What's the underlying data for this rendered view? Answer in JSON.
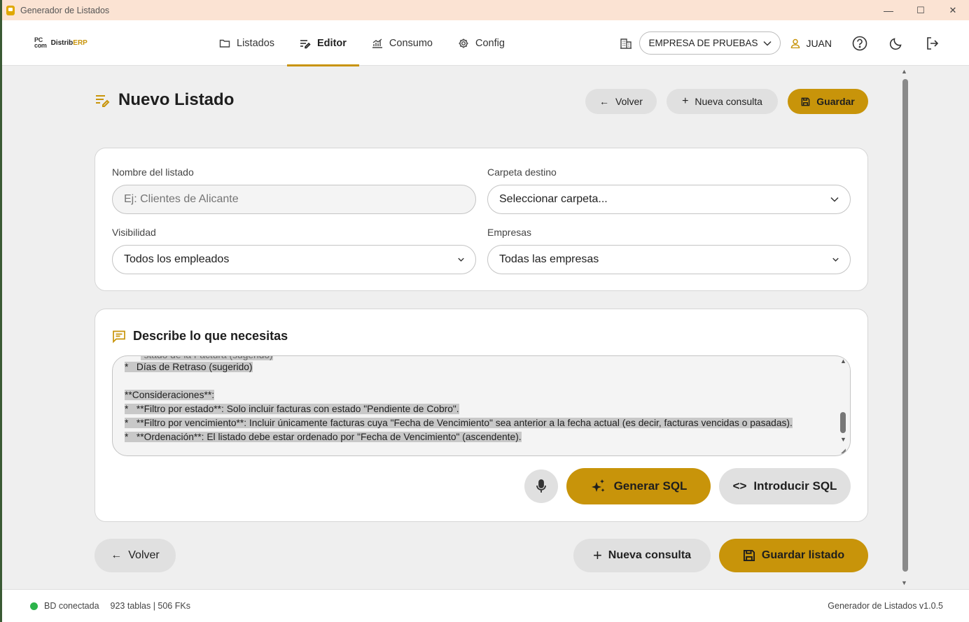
{
  "window": {
    "title": "Generador de Listados",
    "minimize": "—",
    "maximize": "☐",
    "close": "✕"
  },
  "logo": {
    "pc_top": "PC",
    "pc_bottom": "com",
    "distrib": "Distrib",
    "erp": "ERP"
  },
  "nav": {
    "tabs": [
      {
        "label": "Listados",
        "icon": "folder-icon"
      },
      {
        "label": "Editor",
        "icon": "edit-list-icon",
        "active": true
      },
      {
        "label": "Consumo",
        "icon": "chart-icon"
      },
      {
        "label": "Config",
        "icon": "gear-icon"
      }
    ],
    "company": "EMPRESA DE PRUEBAS",
    "user": "JUAN"
  },
  "header": {
    "title": "Nuevo Listado",
    "back": "Volver",
    "new_query": "Nueva consulta",
    "save": "Guardar"
  },
  "form": {
    "name_label": "Nombre del listado",
    "name_placeholder": "Ej: Clientes de Alicante",
    "folder_label": "Carpeta destino",
    "folder_value": "Seleccionar carpeta...",
    "visibility_label": "Visibilidad",
    "visibility_value": "Todos los empleados",
    "companies_label": "Empresas",
    "companies_value": "Todas las empresas"
  },
  "describe": {
    "title": "Describe lo que necesitas",
    "lines": [
      "*   Días de Retraso (sugerido)",
      "",
      "**Consideraciones**:",
      "*   **Filtro por estado**: Solo incluir facturas con estado \"Pendiente de Cobro\".",
      "*   **Filtro por vencimiento**: Incluir únicamente facturas cuya \"Fecha de Vencimiento\" sea anterior a la fecha actual (es decir, facturas vencidas o pasadas).",
      "*   **Ordenación**: El listado debe estar ordenado por \"Fecha de Vencimiento\" (ascendente)."
    ],
    "generate": "Generar SQL",
    "enter_sql": "Introducir SQL"
  },
  "footer": {
    "back": "Volver",
    "new_query": "Nueva consulta",
    "save_list": "Guardar listado"
  },
  "status": {
    "db": "BD conectada",
    "stats": "923 tablas | 506 FKs",
    "version": "Generador de Listados v1.0.5"
  },
  "colors": {
    "accent": "#c8940a",
    "status_ok": "#2cb34a"
  }
}
